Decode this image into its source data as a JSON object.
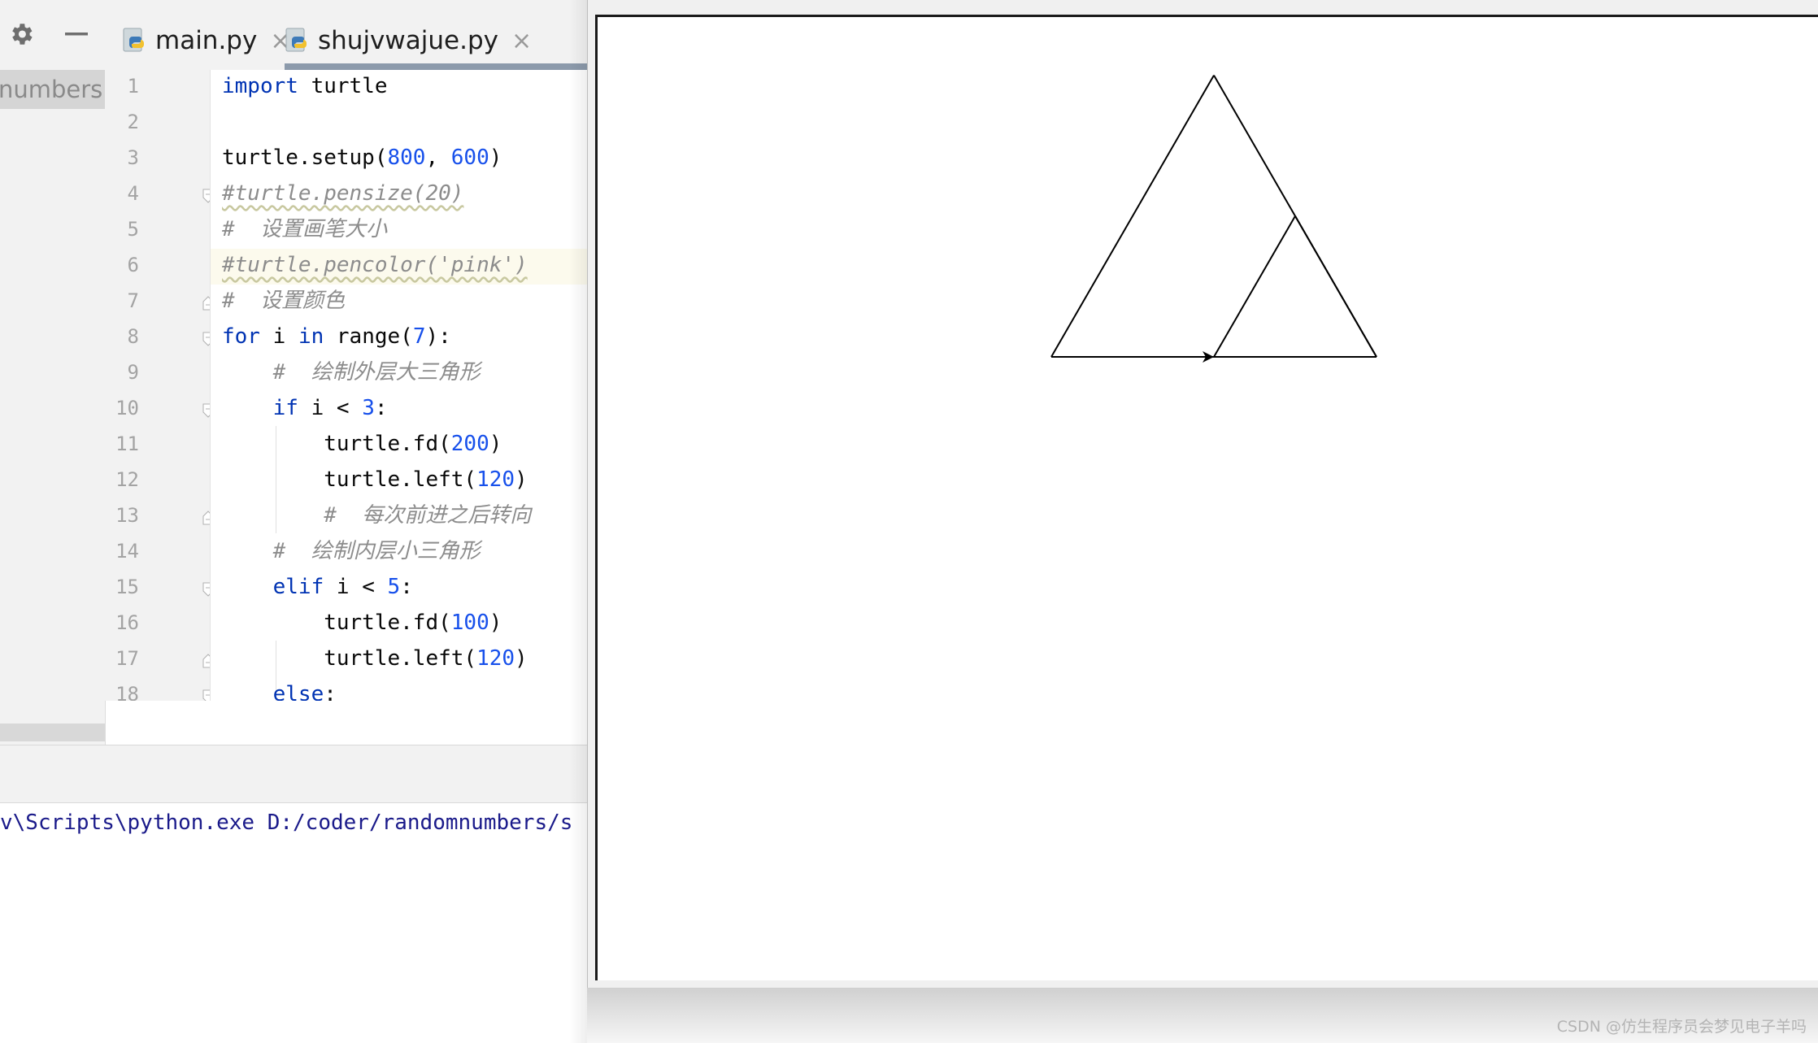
{
  "tool_window": {
    "gear_icon": "gear-icon",
    "minimize_icon": "minimize-icon",
    "project_root": "numbers"
  },
  "tabs": [
    {
      "label": "main.py",
      "icon": "python-file-icon",
      "close": "×"
    },
    {
      "label": "shujvwajue.py",
      "icon": "python-file-icon",
      "close": "×"
    }
  ],
  "editor": {
    "line_numbers": [
      "1",
      "2",
      "3",
      "4",
      "5",
      "6",
      "7",
      "8",
      "9",
      "10",
      "11",
      "12",
      "13",
      "14",
      "15",
      "16",
      "17",
      "18"
    ],
    "current_line": 6
  },
  "console": {
    "command": "v\\Scripts\\python.exe D:/coder/randomnumbers/s"
  },
  "turtle": {
    "setup_width": 800,
    "setup_height": 600,
    "outer_side": 200,
    "inner_side": 100,
    "turn_angle": 120
  },
  "watermark": "CSDN @仿生程序员会梦见电子羊吗"
}
